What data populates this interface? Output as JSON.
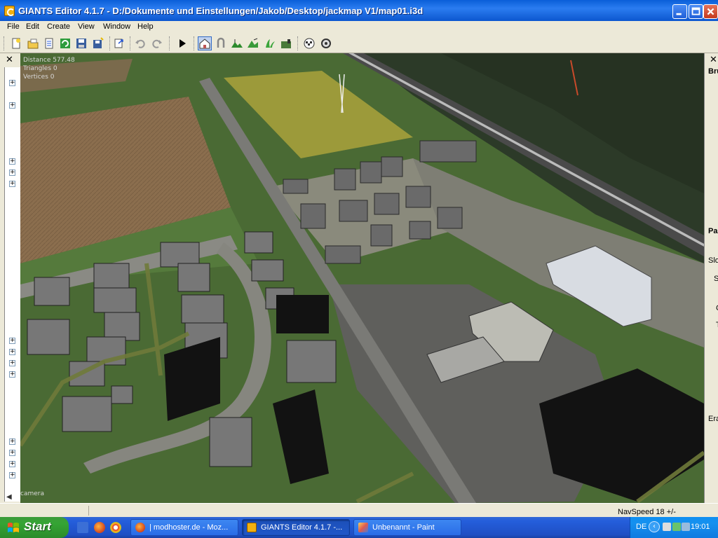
{
  "window": {
    "title": "GIANTS Editor 4.1.7 - D:/Dokumente und Einstellungen/Jakob/Desktop/jackmap V1/map01.i3d"
  },
  "menu": [
    "File",
    "Edit",
    "Create",
    "View",
    "Window",
    "Help"
  ],
  "toolbar": {
    "buttons": [
      "new-icon",
      "open-icon",
      "properties-icon",
      "refresh-icon",
      "save-icon",
      "save-as-icon",
      "export-icon",
      "undo-icon",
      "redo-icon",
      "play-icon",
      "home-icon",
      "select-icon",
      "terrain-icon",
      "sculpt-icon",
      "foliage-icon",
      "texture-icon",
      "checker-icon",
      "gear-icon"
    ],
    "active": "home-icon"
  },
  "viewport": {
    "stats": {
      "distance": "Distance 577.48",
      "triangles": "Triangles 0",
      "vertices": "Vertices 0"
    },
    "camera_label": "camera"
  },
  "right_panel": {
    "labels": [
      "Bru",
      "Pa",
      "Slo",
      "S",
      "C",
      "T",
      "Era"
    ]
  },
  "status": {
    "navspeed": "NavSpeed 18 +/-"
  },
  "taskbar": {
    "start": "Start",
    "tasks": [
      {
        "label": "| modhoster.de - Moz...",
        "active": false
      },
      {
        "label": "GIANTS Editor 4.1.7 -...",
        "active": true
      },
      {
        "label": "Unbenannt - Paint",
        "active": false
      }
    ],
    "lang": "DE",
    "clock": "19:01"
  }
}
